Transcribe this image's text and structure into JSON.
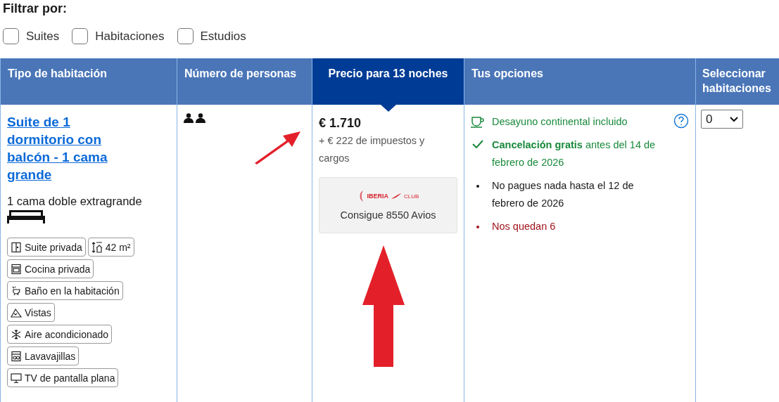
{
  "filter": {
    "title": "Filtrar por:",
    "options": [
      {
        "label": "Suites",
        "checked": false
      },
      {
        "label": "Habitaciones",
        "checked": false
      },
      {
        "label": "Estudios",
        "checked": false
      }
    ]
  },
  "table": {
    "columns": [
      {
        "label": "Tipo de habitación",
        "selected": false
      },
      {
        "label": "Número de personas",
        "selected": false
      },
      {
        "label": "Precio para 13 noches",
        "selected": true
      },
      {
        "label": "Tus opciones",
        "selected": false
      },
      {
        "label": "Seleccionar habitaciones",
        "selected": false
      }
    ],
    "row": {
      "room_name": "Suite de 1 dormitorio con balcón - 1 cama grande",
      "bed": "1 cama doble extragrande",
      "amenities": [
        {
          "label": "Suite privada",
          "kind": "door"
        },
        {
          "label": "42 m²",
          "kind": "size"
        },
        {
          "label": "Cocina privada",
          "kind": "oven"
        },
        {
          "label": "Baño en la habitación",
          "kind": "bath"
        },
        {
          "label": "Vistas",
          "kind": "mountain"
        },
        {
          "label": "Aire acondicionado",
          "kind": "snow"
        },
        {
          "label": "Lavavajillas",
          "kind": "dishwasher"
        },
        {
          "label": "TV de pantalla plana",
          "kind": "tv"
        }
      ],
      "price": "€ 1.710",
      "taxes": "+ € 222 de impuestos y cargos",
      "loyalty": {
        "logo_text": "IBERIA",
        "logo_suffix": "CLUB",
        "label": "Consigue 8550 Avios"
      },
      "options": [
        {
          "kind": "meal",
          "text": "Desayuno continental incluido"
        },
        {
          "kind": "cancel",
          "text": "**Cancelación gratis** antes del 14 de febrero de 2026"
        },
        {
          "kind": "bullet",
          "text": "No pagues nada hasta el 12 de febrero de 2026"
        },
        {
          "kind": "alert",
          "text": "Nos quedan 6"
        }
      ],
      "quantity": "0"
    }
  }
}
